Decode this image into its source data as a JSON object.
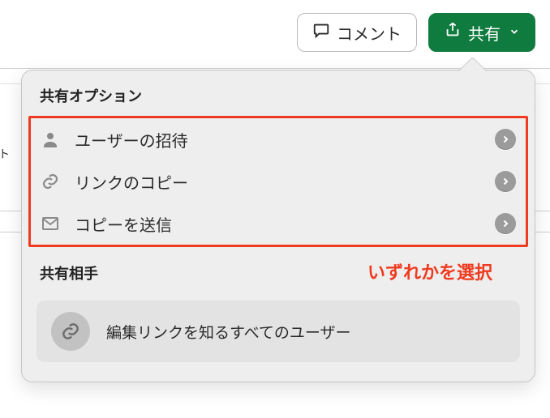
{
  "topbar": {
    "comment_label": "コメント",
    "share_label": "共有"
  },
  "popover": {
    "title": "共有オプション",
    "items": [
      {
        "icon": "person-icon",
        "label": "ユーザーの招待"
      },
      {
        "icon": "link-icon",
        "label": "リンクのコピー"
      },
      {
        "icon": "mail-icon",
        "label": "コピーを送信"
      }
    ],
    "recipients_title": "共有相手",
    "annotation": "いずれかを選択",
    "recipient_summary": "編集リンクを知るすべてのユーザー"
  }
}
